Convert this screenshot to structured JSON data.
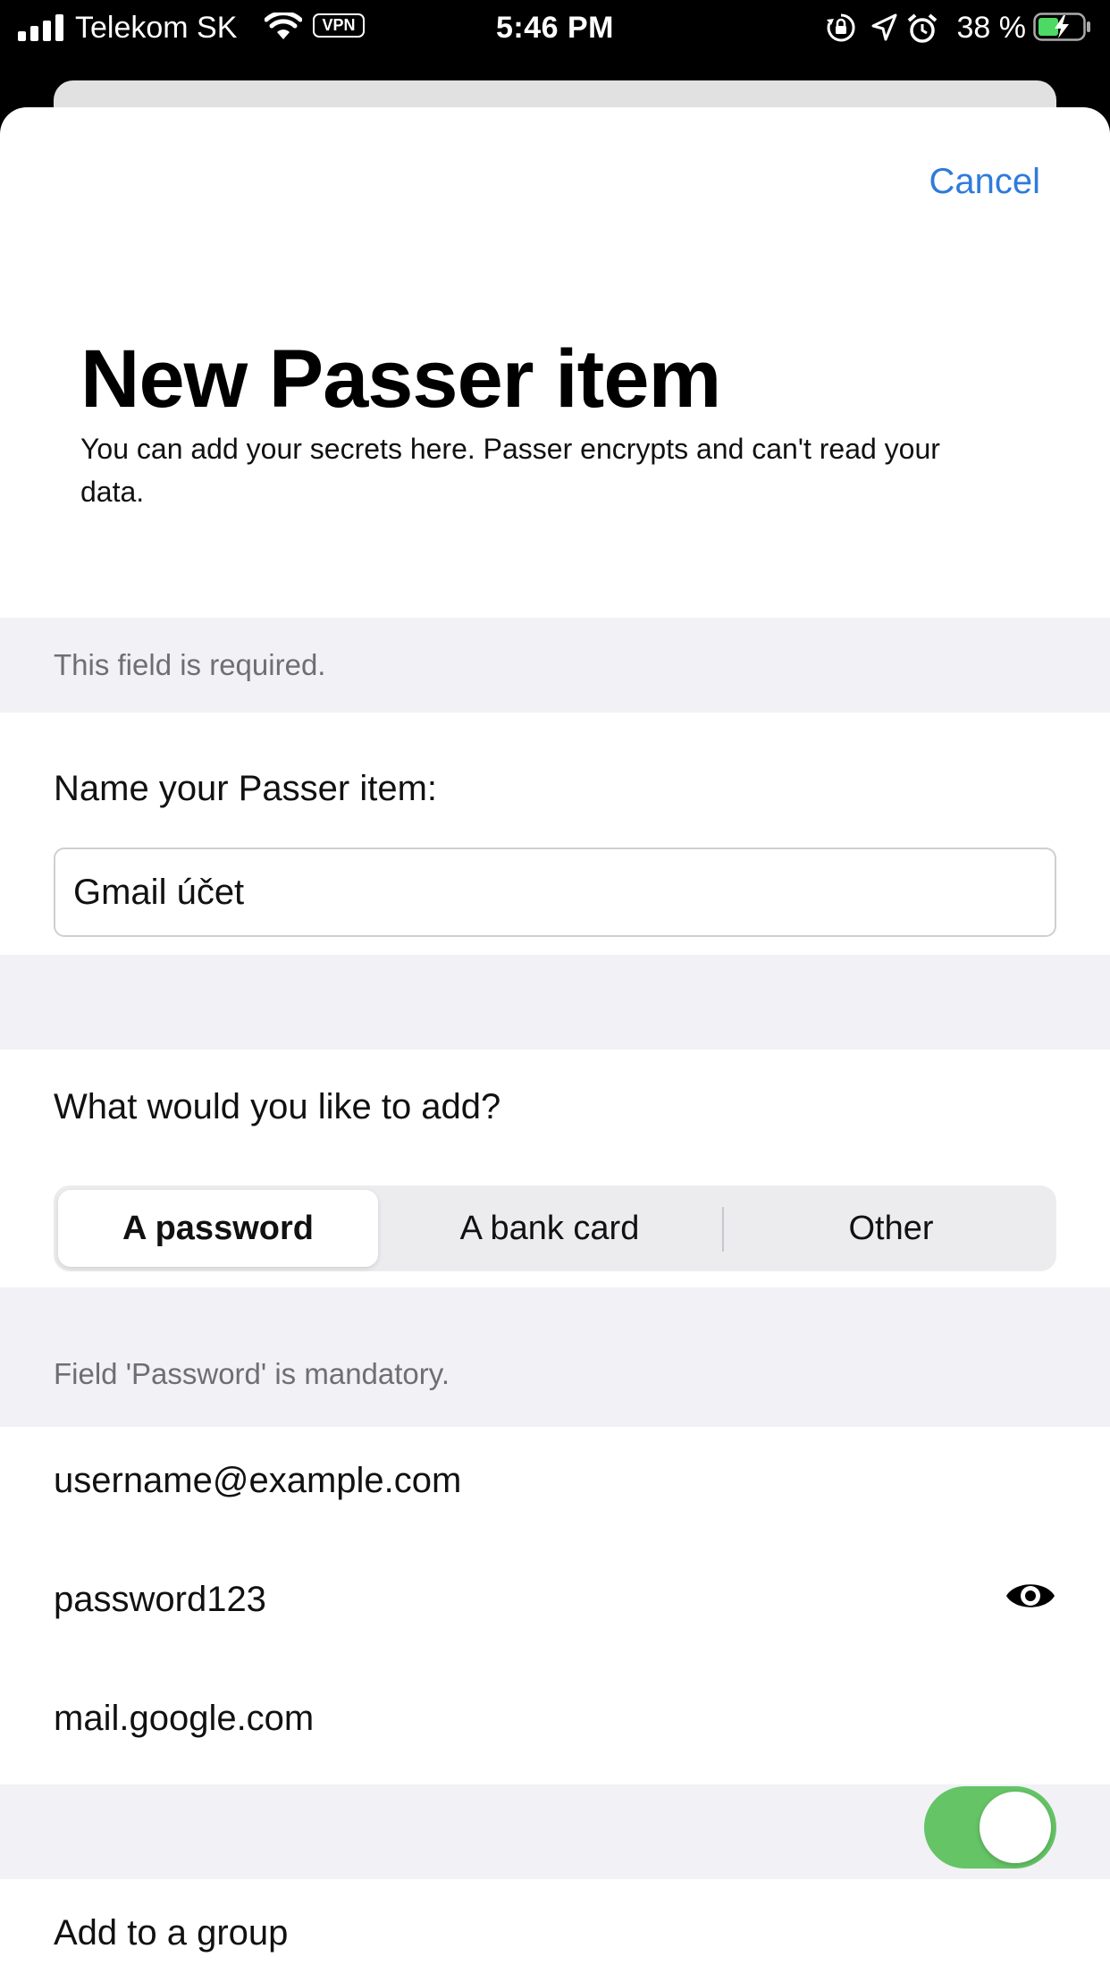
{
  "status_bar": {
    "carrier": "Telekom SK",
    "vpn": "VPN",
    "time": "5:46 PM",
    "battery": "38 %"
  },
  "header": {
    "cancel": "Cancel",
    "title": "New Passer item",
    "subtitle": "You can add your secrets here. Passer encrypts and can't read your data."
  },
  "name_section": {
    "required_note": "This field is required.",
    "label": "Name your Passer item:",
    "value": "Gmail účet"
  },
  "type_section": {
    "label": "What would you like to add?",
    "options": [
      "A password",
      "A bank card",
      "Other"
    ],
    "selected": "A password"
  },
  "credentials": {
    "mandatory_note": "Field 'Password' is mandatory.",
    "username": "username@example.com",
    "password": "password123",
    "website": "mail.google.com"
  },
  "group": {
    "label": "Add to a group",
    "enabled": true
  },
  "colors": {
    "accent": "#2f7bda",
    "toggle_on": "#65c466",
    "section_bg": "#f1f1f6"
  }
}
